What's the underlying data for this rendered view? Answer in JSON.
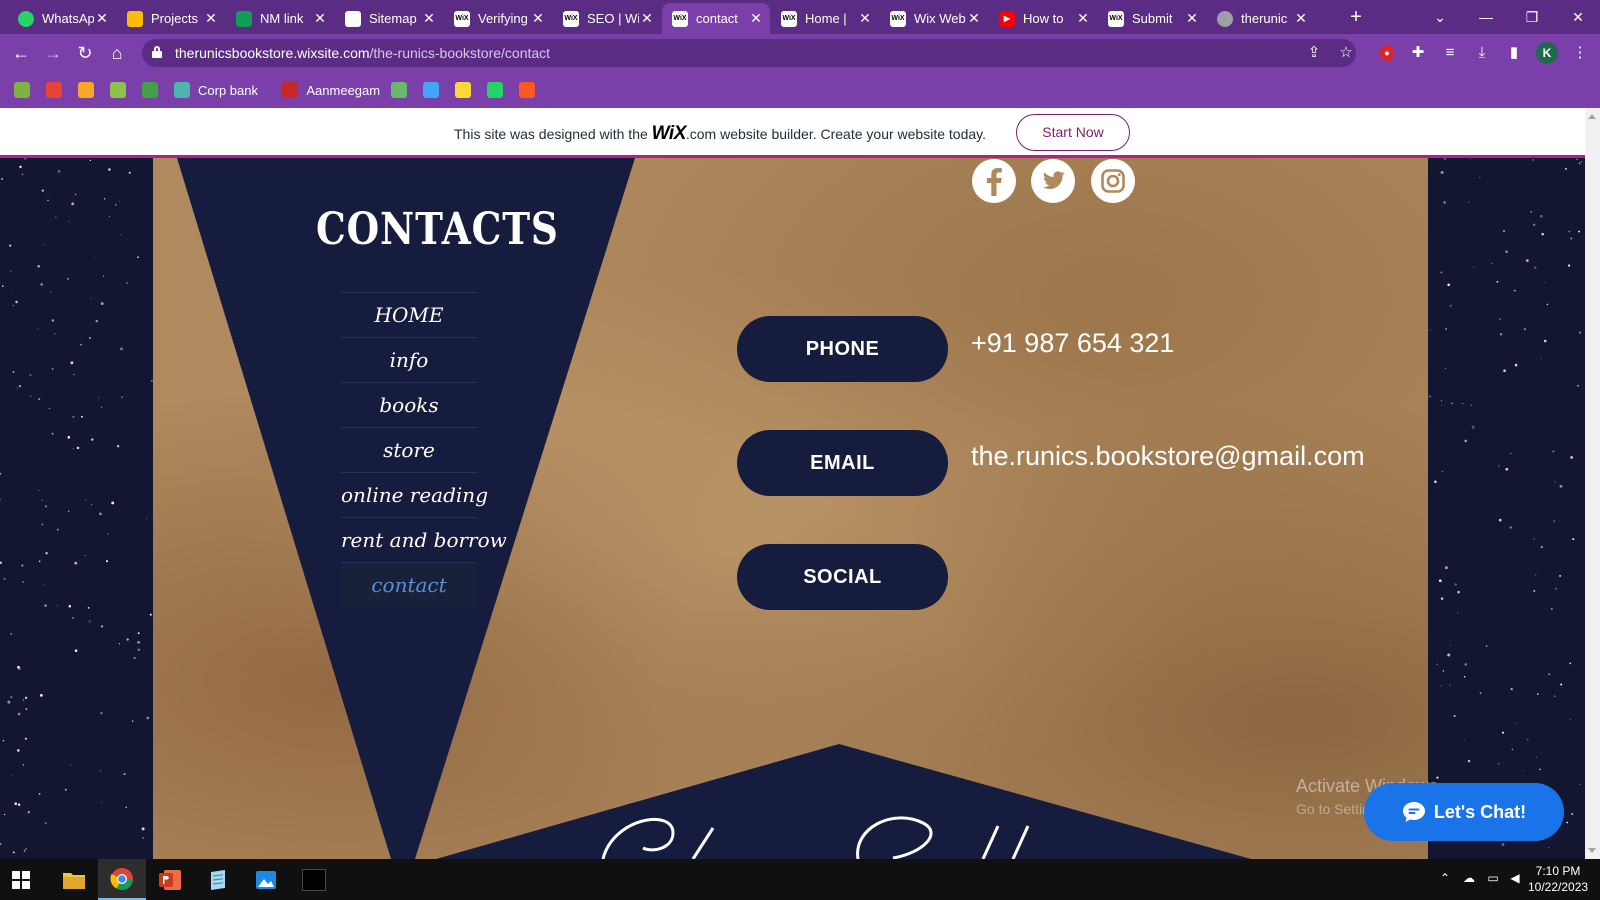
{
  "browser": {
    "tabs": [
      {
        "title": "WhatsApp",
        "icon": "whatsapp-icon",
        "color": "#25d366"
      },
      {
        "title": "Projects",
        "icon": "google-drive-icon",
        "color": "#fbbc04"
      },
      {
        "title": "NM link",
        "icon": "google-sheets-icon",
        "color": "#0f9d58"
      },
      {
        "title": "Sitemap",
        "icon": "sitemap-icon",
        "color": "#ffffff"
      },
      {
        "title": "Verifying",
        "icon": "wix-icon",
        "color": "#ffffff"
      },
      {
        "title": "SEO | Wix",
        "icon": "wix-icon",
        "color": "#ffffff"
      },
      {
        "title": "contact",
        "icon": "wix-icon",
        "color": "#ffffff",
        "active": true
      },
      {
        "title": "Home |",
        "icon": "wix-icon",
        "color": "#ffffff"
      },
      {
        "title": "Wix Web",
        "icon": "wix-icon",
        "color": "#ffffff"
      },
      {
        "title": "How to",
        "icon": "youtube-icon",
        "color": "#ff0000"
      },
      {
        "title": "Submit",
        "icon": "wix-icon",
        "color": "#ffffff"
      },
      {
        "title": "therunic",
        "icon": "globe-icon",
        "color": "#9aa0a6"
      }
    ],
    "url_domain": "therunicsbookstore.wixsite.com",
    "url_path": "/the-runics-bookstore/contact",
    "profile_initial": "K",
    "bookmarks": [
      {
        "label": "",
        "icon": "bookmark-app-icon",
        "color": "#7cb342"
      },
      {
        "label": "",
        "icon": "gmail-icon",
        "color": "#ea4335"
      },
      {
        "label": "",
        "icon": "crown-icon",
        "color": "#f9a825"
      },
      {
        "label": "",
        "icon": "leaf-icon",
        "color": "#8bc34a"
      },
      {
        "label": "",
        "icon": "plant-icon",
        "color": "#43a047"
      },
      {
        "label": "Corp bank",
        "icon": "bank-icon",
        "color": "#4db6ac"
      },
      {
        "label": "Aanmeegam",
        "icon": "temple-icon",
        "color": "#c62828"
      },
      {
        "label": "",
        "icon": "moon-icon",
        "color": "#66bb6a"
      },
      {
        "label": "",
        "icon": "chart-bookmark-icon",
        "color": "#42a5f5"
      },
      {
        "label": "",
        "icon": "photo-bookmark-icon",
        "color": "#fdd835"
      },
      {
        "label": "",
        "icon": "whatsapp-icon",
        "color": "#25d366"
      },
      {
        "label": "",
        "icon": "k-bookmark-icon",
        "color": "#ff5722"
      }
    ]
  },
  "wix_banner": {
    "text_before": "This site was designed with the ",
    "logo": "WiX",
    "logo_suffix": ".com",
    "text_after": " website builder. Create your website today.",
    "cta": "Start Now"
  },
  "site": {
    "heading": "CONTACTS",
    "nav": [
      {
        "label": "HOME",
        "active": false
      },
      {
        "label": "info",
        "active": false
      },
      {
        "label": "books",
        "active": false
      },
      {
        "label": "store",
        "active": false
      },
      {
        "label": "online reading",
        "active": false
      },
      {
        "label": "rent and borrow",
        "active": false
      },
      {
        "label": "contact",
        "active": true
      }
    ],
    "phone_label": "PHONE",
    "phone_value": "+91 987 654 321",
    "email_label": "EMAIL",
    "email_value": "the.runics.bookstore@gmail.com",
    "social_label": "SOCIAL",
    "social_icons": [
      "facebook-icon",
      "twitter-icon",
      "instagram-icon"
    ],
    "chat_label": "Let's Chat!"
  },
  "os": {
    "activate_title": "Activate Windows",
    "activate_sub": "Go to Settings to activate Windows.",
    "time": "7:10 PM",
    "date": "10/22/2023"
  },
  "colors": {
    "chrome_dark": "#5b2c83",
    "chrome_light": "#7a3fa8",
    "navy": "#161c3e",
    "parchment": "#b08a5e",
    "chat_blue": "#1a73e8",
    "wix_magenta": "#b51d8a"
  }
}
